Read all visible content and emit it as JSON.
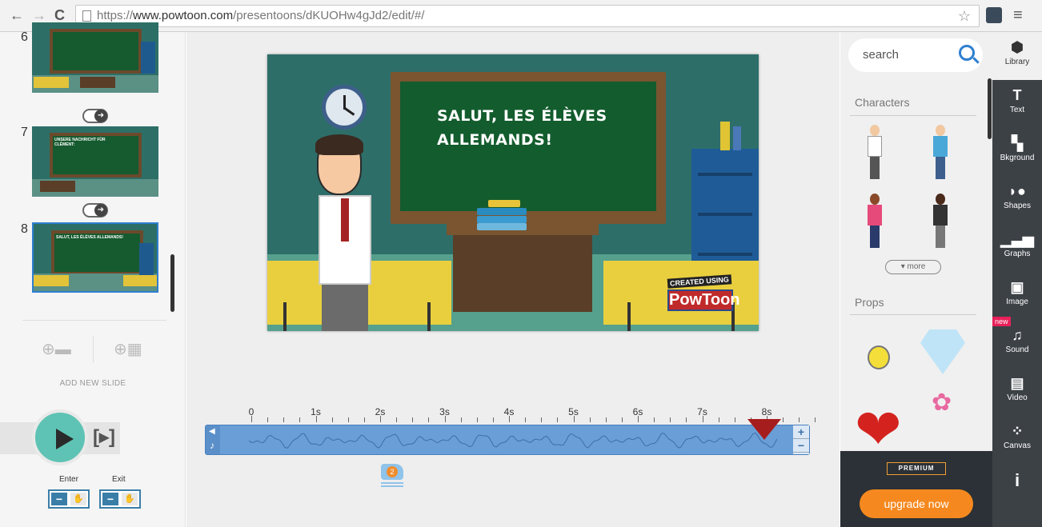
{
  "browser": {
    "url_prefix": "https://",
    "url_domain": "www.powtoon.com",
    "url_path": "/presentoons/dKUOHw4gJd2/edit/#/"
  },
  "slides": {
    "items": [
      {
        "number": "6",
        "text": ""
      },
      {
        "number": "7",
        "text": "UNSERE NACHRICHT FÜR CLÉMENT:"
      },
      {
        "number": "8",
        "text": "SALUT, LES ÉLÈVES ALLEMANDS!"
      }
    ],
    "add_label": "ADD NEW SLIDE"
  },
  "player": {
    "enter_label": "Enter",
    "exit_label": "Exit",
    "play_from_here": "[▸]"
  },
  "stage": {
    "chalkboard_text": "SALUT, LES ÉLÈVES ALLEMANDS!",
    "badge_small": "CREATED USING",
    "badge_logo": "PowToon"
  },
  "timeline": {
    "ticks": [
      "0",
      "1s",
      "2s",
      "3s",
      "4s",
      "5s",
      "6s",
      "7s",
      "8s"
    ],
    "marker_count": "2",
    "zoom_in": "+",
    "zoom_out": "−"
  },
  "library": {
    "search_placeholder": "search",
    "characters_title": "Characters",
    "more_label": "more",
    "props_title": "Props",
    "premium_label": "PREMIUM",
    "upgrade_label": "upgrade now"
  },
  "toolbar": {
    "items": [
      {
        "label": "Library",
        "icon": "library-icon"
      },
      {
        "label": "Text",
        "icon": "text-icon"
      },
      {
        "label": "Bkground",
        "icon": "background-icon"
      },
      {
        "label": "Shapes",
        "icon": "shapes-icon"
      },
      {
        "label": "Graphs",
        "icon": "graphs-icon"
      },
      {
        "label": "Image",
        "icon": "image-icon"
      },
      {
        "label": "Sound",
        "icon": "sound-icon"
      },
      {
        "label": "Video",
        "icon": "video-icon"
      },
      {
        "label": "Canvas",
        "icon": "canvas-icon"
      }
    ],
    "new_badge": "new",
    "info": "i"
  },
  "colors": {
    "accent_teal": "#5ec3b4",
    "timeline_blue": "#6a9ed6",
    "upgrade_orange": "#f5891f",
    "toolbar_dark": "#3c4146"
  }
}
